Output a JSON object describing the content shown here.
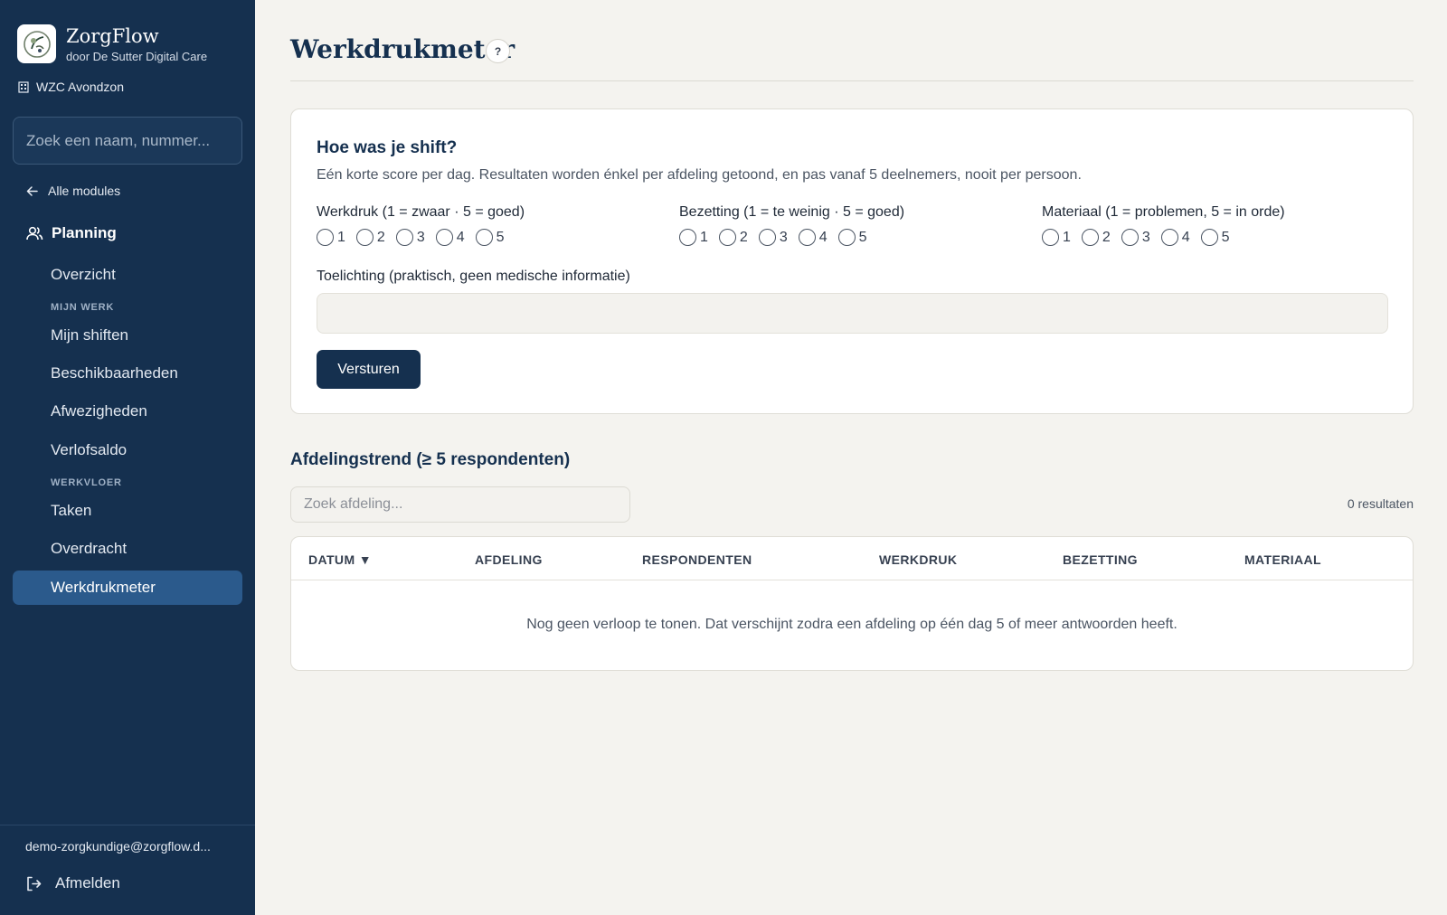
{
  "sidebar": {
    "brand_name": "ZorgFlow",
    "brand_sub": "door De Sutter Digital Care",
    "org": "WZC Avondzon",
    "search_placeholder": "Zoek een naam, nummer...",
    "back_label": "Alle modules",
    "section_label": "Planning",
    "overview": "Overzicht",
    "group_my_work": "MIJN WERK",
    "my_shifts": "Mijn shiften",
    "availability": "Beschikbaarheden",
    "absences": "Afwezigheden",
    "leave_balance": "Verlofsaldo",
    "group_floor": "WERKVLOER",
    "tasks": "Taken",
    "handover": "Overdracht",
    "workload_meter": "Werkdrukmeter",
    "user_email": "demo-zorgkundige@zorgflow.d...",
    "logout": "Afmelden"
  },
  "page": {
    "title": "Werkdrukmeter",
    "help": "?"
  },
  "survey": {
    "title": "Hoe was je shift?",
    "description": "Eén korte score per dag. Resultaten worden énkel per afdeling getoond, en pas vanaf 5 deelnemers, nooit per persoon.",
    "q1_label": "Werkdruk (1 = zwaar · 5 = goed)",
    "q2_label": "Bezetting (1 = te weinig · 5 = goed)",
    "q3_label": "Materiaal (1 = problemen, 5 = in orde)",
    "options": [
      "1",
      "2",
      "3",
      "4",
      "5"
    ],
    "note_label": "Toelichting (praktisch, geen medische informatie)",
    "note_value": "",
    "submit": "Versturen"
  },
  "trend": {
    "title": "Afdelingstrend (≥ 5 respondenten)",
    "search_placeholder": "Zoek afdeling...",
    "result_count": "0 resultaten",
    "columns": [
      "DATUM ▼",
      "AFDELING",
      "RESPONDENTEN",
      "WERKDRUK",
      "BEZETTING",
      "MATERIAAL"
    ],
    "empty_message": "Nog geen verloop te tonen. Dat verschijnt zodra een afdeling op één dag 5 of meer antwoorden heeft."
  }
}
